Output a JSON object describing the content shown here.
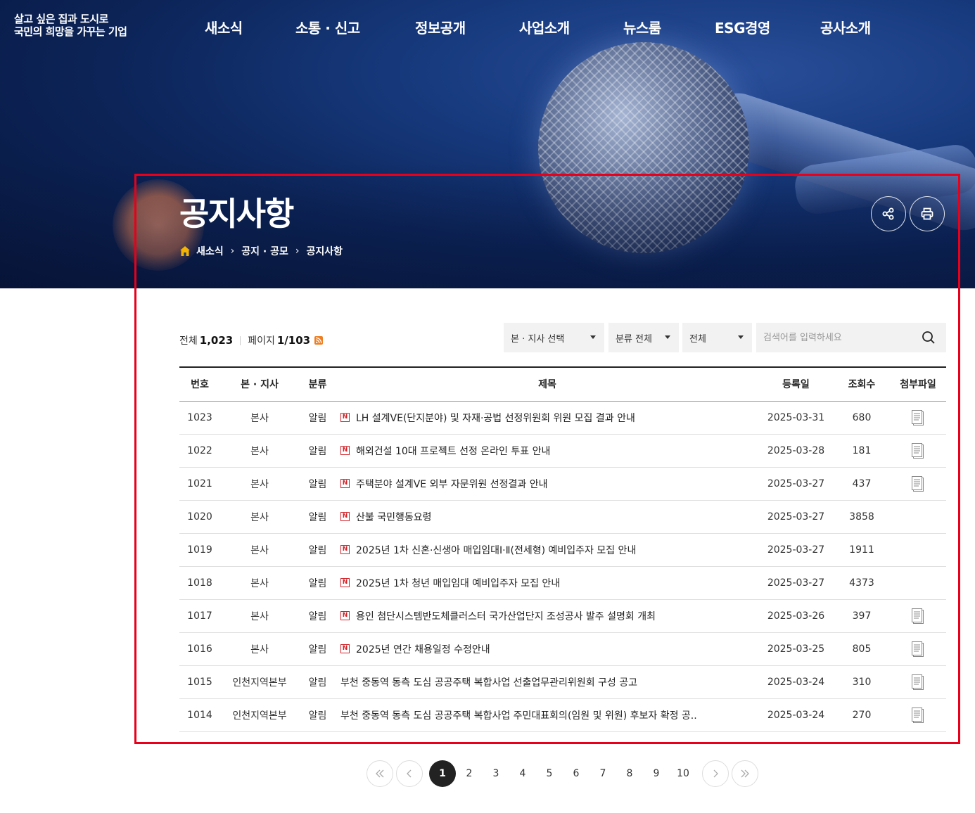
{
  "header": {
    "logo_line1": "살고 싶은 집과 도시로",
    "logo_line2": "국민의 희망을 가꾸는 기업",
    "nav": [
      "새소식",
      "소통 · 신고",
      "정보공개",
      "사업소개",
      "뉴스룸",
      "ESG경영",
      "공사소개"
    ]
  },
  "hero": {
    "title": "공지사항",
    "breadcrumb": [
      "새소식",
      "공지 · 공모",
      "공지사항"
    ],
    "share_icon": "share-icon",
    "print_icon": "print-icon"
  },
  "summary": {
    "total_label": "전체",
    "total_count": "1,023",
    "page_label": "페이지",
    "page_value": "1/103",
    "rss_icon": "rss-icon"
  },
  "filters": {
    "branch": "본 · 지사 선택",
    "category": "분류 전체",
    "scope": "전체",
    "search_placeholder": "검색어를 입력하세요"
  },
  "table": {
    "headers": [
      "번호",
      "본 · 지사",
      "분류",
      "제목",
      "등록일",
      "조회수",
      "첨부파일"
    ],
    "rows": [
      {
        "no": "1023",
        "branch": "본사",
        "category": "알림",
        "new": true,
        "title": "LH 설계VE(단지분야) 및 자재·공법 선정위원회 위원 모집 결과 안내",
        "date": "2025-03-31",
        "views": "680",
        "attachment": true
      },
      {
        "no": "1022",
        "branch": "본사",
        "category": "알림",
        "new": true,
        "title": "해외건설 10대 프로젝트 선정 온라인 투표 안내",
        "date": "2025-03-28",
        "views": "181",
        "attachment": true
      },
      {
        "no": "1021",
        "branch": "본사",
        "category": "알림",
        "new": true,
        "title": "주택분야 설계VE 외부 자문위원 선정결과 안내",
        "date": "2025-03-27",
        "views": "437",
        "attachment": true
      },
      {
        "no": "1020",
        "branch": "본사",
        "category": "알림",
        "new": true,
        "title": "산불 국민행동요령",
        "date": "2025-03-27",
        "views": "3858",
        "attachment": false
      },
      {
        "no": "1019",
        "branch": "본사",
        "category": "알림",
        "new": true,
        "title": "2025년 1차 신혼·신생아 매입임대Ⅰ·Ⅱ(전세형) 예비입주자 모집 안내",
        "date": "2025-03-27",
        "views": "1911",
        "attachment": false
      },
      {
        "no": "1018",
        "branch": "본사",
        "category": "알림",
        "new": true,
        "title": "2025년 1차 청년 매입임대 예비입주자 모집 안내",
        "date": "2025-03-27",
        "views": "4373",
        "attachment": false
      },
      {
        "no": "1017",
        "branch": "본사",
        "category": "알림",
        "new": true,
        "title": "용인 첨단시스템반도체클러스터 국가산업단지 조성공사 발주 설명회 개최",
        "date": "2025-03-26",
        "views": "397",
        "attachment": true
      },
      {
        "no": "1016",
        "branch": "본사",
        "category": "알림",
        "new": true,
        "title": "2025년 연간 채용일정 수정안내",
        "date": "2025-03-25",
        "views": "805",
        "attachment": true
      },
      {
        "no": "1015",
        "branch": "인천지역본부",
        "category": "알림",
        "new": false,
        "title": "부천 중동역 동측 도심 공공주택 복합사업 선출업무관리위원회 구성 공고",
        "date": "2025-03-24",
        "views": "310",
        "attachment": true
      },
      {
        "no": "1014",
        "branch": "인천지역본부",
        "category": "알림",
        "new": false,
        "title": "부천 중동역 동측 도심 공공주택 복합사업 주민대표회의(임원 및 위원) 후보자 확정 공..",
        "date": "2025-03-24",
        "views": "270",
        "attachment": true
      }
    ],
    "new_badge": "N",
    "file_icon": "document-icon"
  },
  "pagination": {
    "pages": [
      "1",
      "2",
      "3",
      "4",
      "5",
      "6",
      "7",
      "8",
      "9",
      "10"
    ],
    "current": "1"
  },
  "colors": {
    "highlight": "#e8001a",
    "new_badge": "#d2232a",
    "rss": "#f07e21",
    "home": "#f5b400"
  }
}
